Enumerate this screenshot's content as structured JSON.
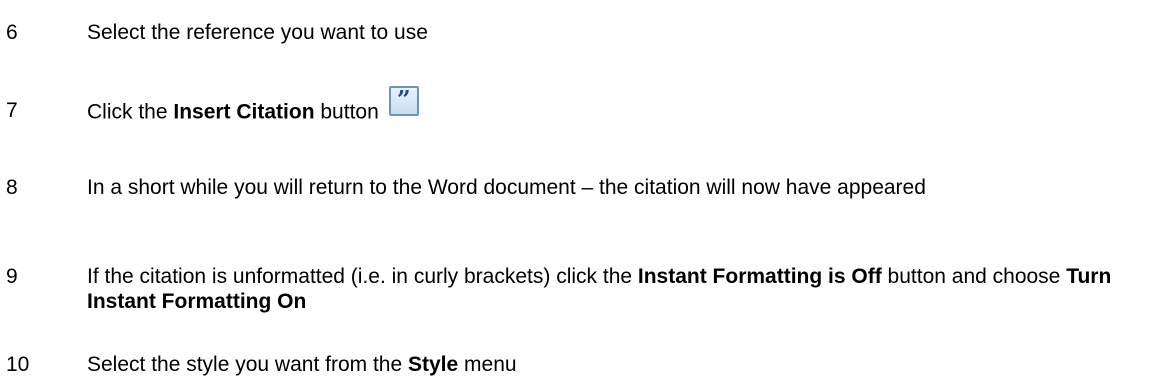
{
  "steps": [
    {
      "number": "6",
      "parts": [
        "Select the reference you want to use"
      ]
    },
    {
      "number": "7",
      "parts": [
        "Click the ",
        "Insert Citation",
        " button"
      ],
      "icon": "insert-citation-icon",
      "icon_glyph": "”"
    },
    {
      "number": "8",
      "parts": [
        "In a short while you will return to the Word document – the citation will now have appeared"
      ]
    },
    {
      "number": "9",
      "parts": [
        "If the citation is unformatted (i.e. in curly brackets) click the ",
        "Instant Formatting is Off",
        " button and choose ",
        "Turn Instant Formatting On"
      ]
    },
    {
      "number": "10",
      "parts": [
        "Select the style you want from the ",
        "Style",
        " menu"
      ]
    }
  ]
}
